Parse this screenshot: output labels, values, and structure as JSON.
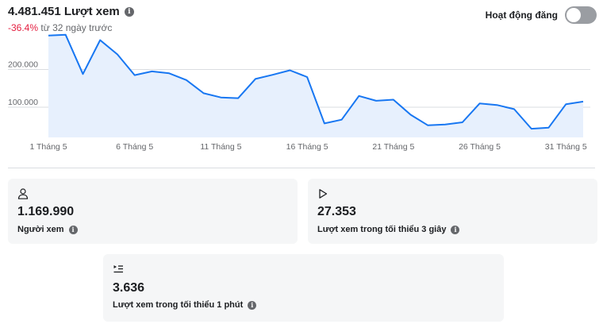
{
  "summary": {
    "total_views": "4.481.451 Lượt xem",
    "change_value": "-36.4%",
    "change_suffix": " từ 32 ngày trước"
  },
  "toggle": {
    "label": "Hoạt động đăng",
    "state": "off"
  },
  "chart_data": {
    "type": "area",
    "x_tick_labels": [
      "1 Tháng 5",
      "6 Tháng 5",
      "11 Tháng 5",
      "16 Tháng 5",
      "21 Tháng 5",
      "26 Tháng 5",
      "31 Tháng 5"
    ],
    "y_tick_labels": [
      "200.000",
      "100.000"
    ],
    "y_ticks": [
      200000,
      100000
    ],
    "ylim": [
      20000,
      300000
    ],
    "grid": true,
    "line_color": "#1877f2",
    "fill_color": "#e7f0fd",
    "series": [
      {
        "x": [
          1,
          2,
          3,
          4,
          5,
          6,
          7,
          8,
          9,
          10,
          11,
          12,
          13,
          14,
          15,
          16,
          17,
          18,
          19,
          20,
          21,
          22,
          23,
          24,
          25,
          26,
          27,
          28,
          29,
          30,
          31,
          32
        ],
        "values": [
          290000,
          292000,
          188000,
          278000,
          240000,
          185000,
          195000,
          190000,
          172000,
          137000,
          126000,
          124000,
          175000,
          186000,
          198000,
          180000,
          57000,
          67000,
          130000,
          117000,
          120000,
          80000,
          52000,
          54000,
          60000,
          110000,
          106000,
          95000,
          43000,
          46000,
          108000,
          115000
        ]
      }
    ]
  },
  "cards": [
    {
      "icon": "person-icon",
      "value": "1.169.990",
      "label": "Người xem"
    },
    {
      "icon": "play-icon",
      "value": "27.353",
      "label": "Lượt xem trong tối thiểu 3 giây"
    },
    {
      "icon": "playlist-play-icon",
      "value": "3.636",
      "label": "Lượt xem trong tối thiểu 1 phút"
    }
  ]
}
